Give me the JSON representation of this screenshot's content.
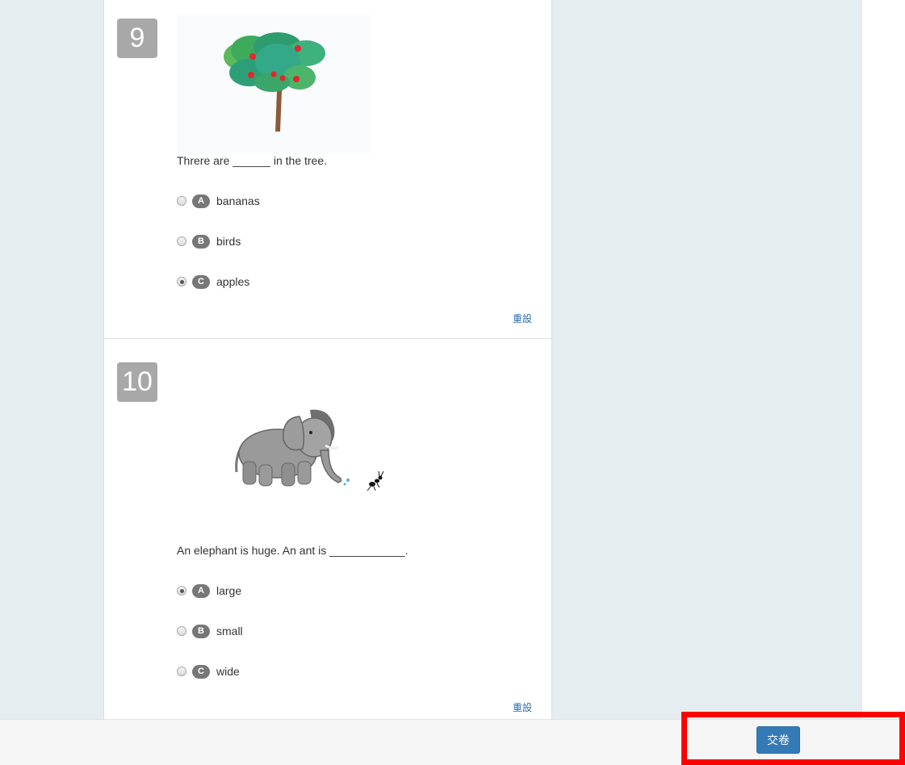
{
  "questions": [
    {
      "number": "9",
      "text": "Threre are ______ in the tree.",
      "options": [
        {
          "letter": "A",
          "label": "bananas",
          "selected": false
        },
        {
          "letter": "B",
          "label": "birds",
          "selected": false
        },
        {
          "letter": "C",
          "label": "apples",
          "selected": true
        }
      ],
      "reset_label": "重設",
      "image_icon": "apple-tree-icon"
    },
    {
      "number": "10",
      "text": "An elephant is huge. An ant is ____________.",
      "options": [
        {
          "letter": "A",
          "label": "large",
          "selected": true
        },
        {
          "letter": "B",
          "label": "small",
          "selected": false
        },
        {
          "letter": "C",
          "label": "wide",
          "selected": false
        }
      ],
      "reset_label": "重設",
      "image_icon": "elephant-and-ant-icon"
    }
  ],
  "footer": {
    "submit_label": "交卷"
  },
  "colors": {
    "accent": "#337ab7",
    "highlight": "#ff0000",
    "badge": "#777777",
    "number_box": "#a8a8a8"
  }
}
